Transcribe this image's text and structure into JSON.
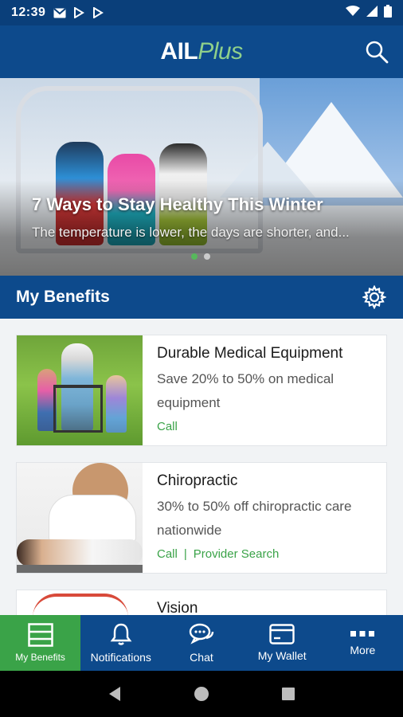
{
  "status_bar": {
    "time": "12:39",
    "icons": [
      "gmail-icon",
      "play-icon",
      "play-icon",
      "wifi-icon",
      "signal-icon",
      "battery-icon"
    ]
  },
  "app_bar": {
    "logo_main": "AIL",
    "logo_accent": "Plus",
    "search_icon": "search-icon"
  },
  "hero": {
    "title": "7 Ways to Stay Healthy This Winter",
    "subtitle": "The temperature is lower, the days are shorter, and..."
  },
  "section": {
    "title": "My Benefits",
    "settings_icon": "gear-icon"
  },
  "benefits": [
    {
      "title": "Durable Medical Equipment",
      "description": "Save 20% to 50% on medical equipment",
      "actions": [
        "Call"
      ]
    },
    {
      "title": "Chiropractic",
      "description": "30% to 50% off chiropractic care nationwide",
      "actions": [
        "Call",
        "Provider Search"
      ]
    },
    {
      "title": "Vision",
      "description": "",
      "actions": []
    }
  ],
  "bottom_nav": [
    {
      "label": "My Benefits",
      "icon": "list-icon",
      "active": true
    },
    {
      "label": "Notifications",
      "icon": "bell-icon",
      "active": false
    },
    {
      "label": "Chat",
      "icon": "chat-icon",
      "active": false
    },
    {
      "label": "My Wallet",
      "icon": "card-icon",
      "active": false
    },
    {
      "label": "More",
      "icon": "dots-icon",
      "active": false
    }
  ],
  "colors": {
    "primary": "#0d4a8c",
    "status_bar": "#0a3f7a",
    "accent_green": "#3aa348",
    "background": "#f1f3f5"
  }
}
